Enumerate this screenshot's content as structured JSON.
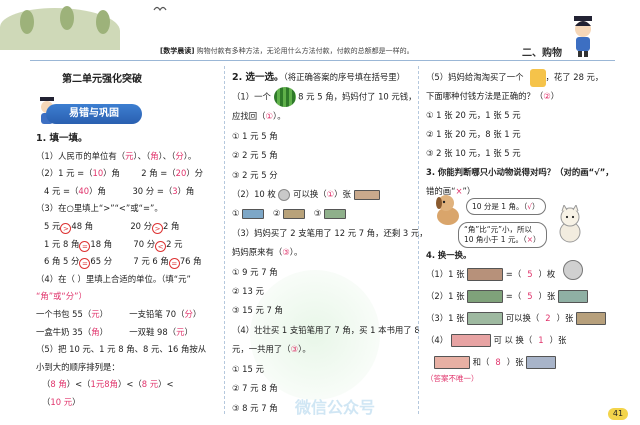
{
  "header": {
    "tagline_label": "[数学晨读]",
    "tagline_text": "购物付款有多种方法，无论用什么方法付款，付款的总额都是一样的。",
    "chapter": "二、购物",
    "page_number": "41"
  },
  "left": {
    "title": "第二单元强化突破",
    "banner": "易错与巩固",
    "q1_title": "1. 填一填。",
    "lines": [
      [
        "（1）人民币的单位有（",
        "元",
        "）、（",
        "角",
        "）、（",
        "分",
        "）。"
      ],
      [
        "（2）1 元 =（",
        "10",
        "）角",
        "        2 角 =（",
        "20",
        "）分"
      ],
      [
        "4 元 =（",
        "40",
        "）角",
        "          30 分 =（",
        "3",
        "）角"
      ],
      [
        "（3）在○里填上“>”“<”或“=”。"
      ],
      [
        "5 元",
        ">",
        "48 角",
        "              20 分",
        ">",
        "2 角"
      ],
      [
        "1 元 8 角",
        "=",
        "18 角",
        "        70 分",
        "<",
        "2 元"
      ],
      [
        "6 角 5 分",
        "=",
        "65 分",
        "        7 元 6 角",
        "=",
        "76 角"
      ],
      [
        "（4）在（        ）里填上合适的单位。（填“元”"
      ],
      [
        "“角”或“分”）"
      ],
      [
        "一个书包 55（",
        "元",
        "）",
        "        一支铅笔 70（",
        "分",
        "）"
      ],
      [
        "一盒牛奶 35（",
        "角",
        "）",
        "        一双鞋 98（",
        "元",
        "）"
      ],
      [
        "（5）把 10 元、1 元 8 角、8 元、16 角按从"
      ],
      [
        "小到大的顺序排列是："
      ],
      [
        "（",
        "8 角",
        "）<（",
        "1元8角",
        "）<（",
        "8 元",
        "）<"
      ],
      [
        "（",
        "10 元",
        "）"
      ]
    ]
  },
  "middle": {
    "q2_title": "2. 选一选。",
    "q2_note": "（将正确答案的序号填在括号里）",
    "q2_1_a": "（1）一个",
    "q2_1_b": "8 元 5 角，妈妈付了 10 元钱，",
    "q2_1_c": "应找回（",
    "q2_1_ans": "①",
    "q2_1_d": "）。",
    "q2_1_opts": [
      "① 1 元 5 角",
      "② 2 元 5 角",
      "③ 2 元 5 分"
    ],
    "q2_2_a": "（2）10 枚",
    "q2_2_b": "可以换（",
    "q2_2_ans": "①",
    "q2_2_c": "）张",
    "q2_2_opts": [
      "①",
      "②",
      "③"
    ],
    "q2_3": [
      "（3）妈妈买了 2 支笔用了 12 元 7 角，还剩 3 元，",
      "妈妈原来有（",
      "③",
      "）。"
    ],
    "q2_3_opts": [
      "① 9 元 7 角",
      "② 13 元",
      "③ 15 元 7 角"
    ],
    "q2_4": [
      "（4）壮壮买 1 支铅笔用了 7 角，买 1 本书用了 8",
      "元，一共用了（",
      "③",
      "）。"
    ],
    "q2_4_opts": [
      "① 15 元",
      "② 7 元 8 角",
      "③ 8 元 7 角"
    ]
  },
  "right": {
    "q2_5_a": "（5）妈妈给淘淘买了一个",
    "q2_5_b": "，花了 28 元，",
    "q2_5_c": "下面哪种付钱方法是正确的？（",
    "q2_5_ans": "②",
    "q2_5_d": "）",
    "q2_5_opts": [
      "① 1 张 20 元，1 张 5 元",
      "② 1 张 20 元，8 张 1 元",
      "③ 2 张 10 元，1 张 5 元"
    ],
    "q3_title": "3. 你能判断哪只小动物说得对吗？（对的画“√”，",
    "q3_sub_a": "错的画“",
    "q3_sub_x": "×",
    "q3_sub_b": "”）",
    "dog_text": "10 分是 1 角。（",
    "dog_ans": "√",
    "dog_end": "）",
    "cat_line1": "“角”比“元”小，所以",
    "cat_line2": "10 角小于 1 元。（",
    "cat_ans": "×",
    "cat_end": "）",
    "q4_title": "4. 换一换。",
    "q4_1": [
      "（1）1 张",
      "=（",
      "5",
      "）枚"
    ],
    "q4_2": [
      "（2）1 张",
      "=（",
      "5",
      "）张"
    ],
    "q4_3": [
      "（3）1 张",
      "可以换（",
      "2",
      "）张"
    ],
    "q4_4": [
      "（4）",
      "可 以 换（",
      "1",
      "）张"
    ],
    "q4_4b": [
      "和（",
      "8",
      "）张"
    ],
    "q4_note": "（答案不唯一）"
  }
}
